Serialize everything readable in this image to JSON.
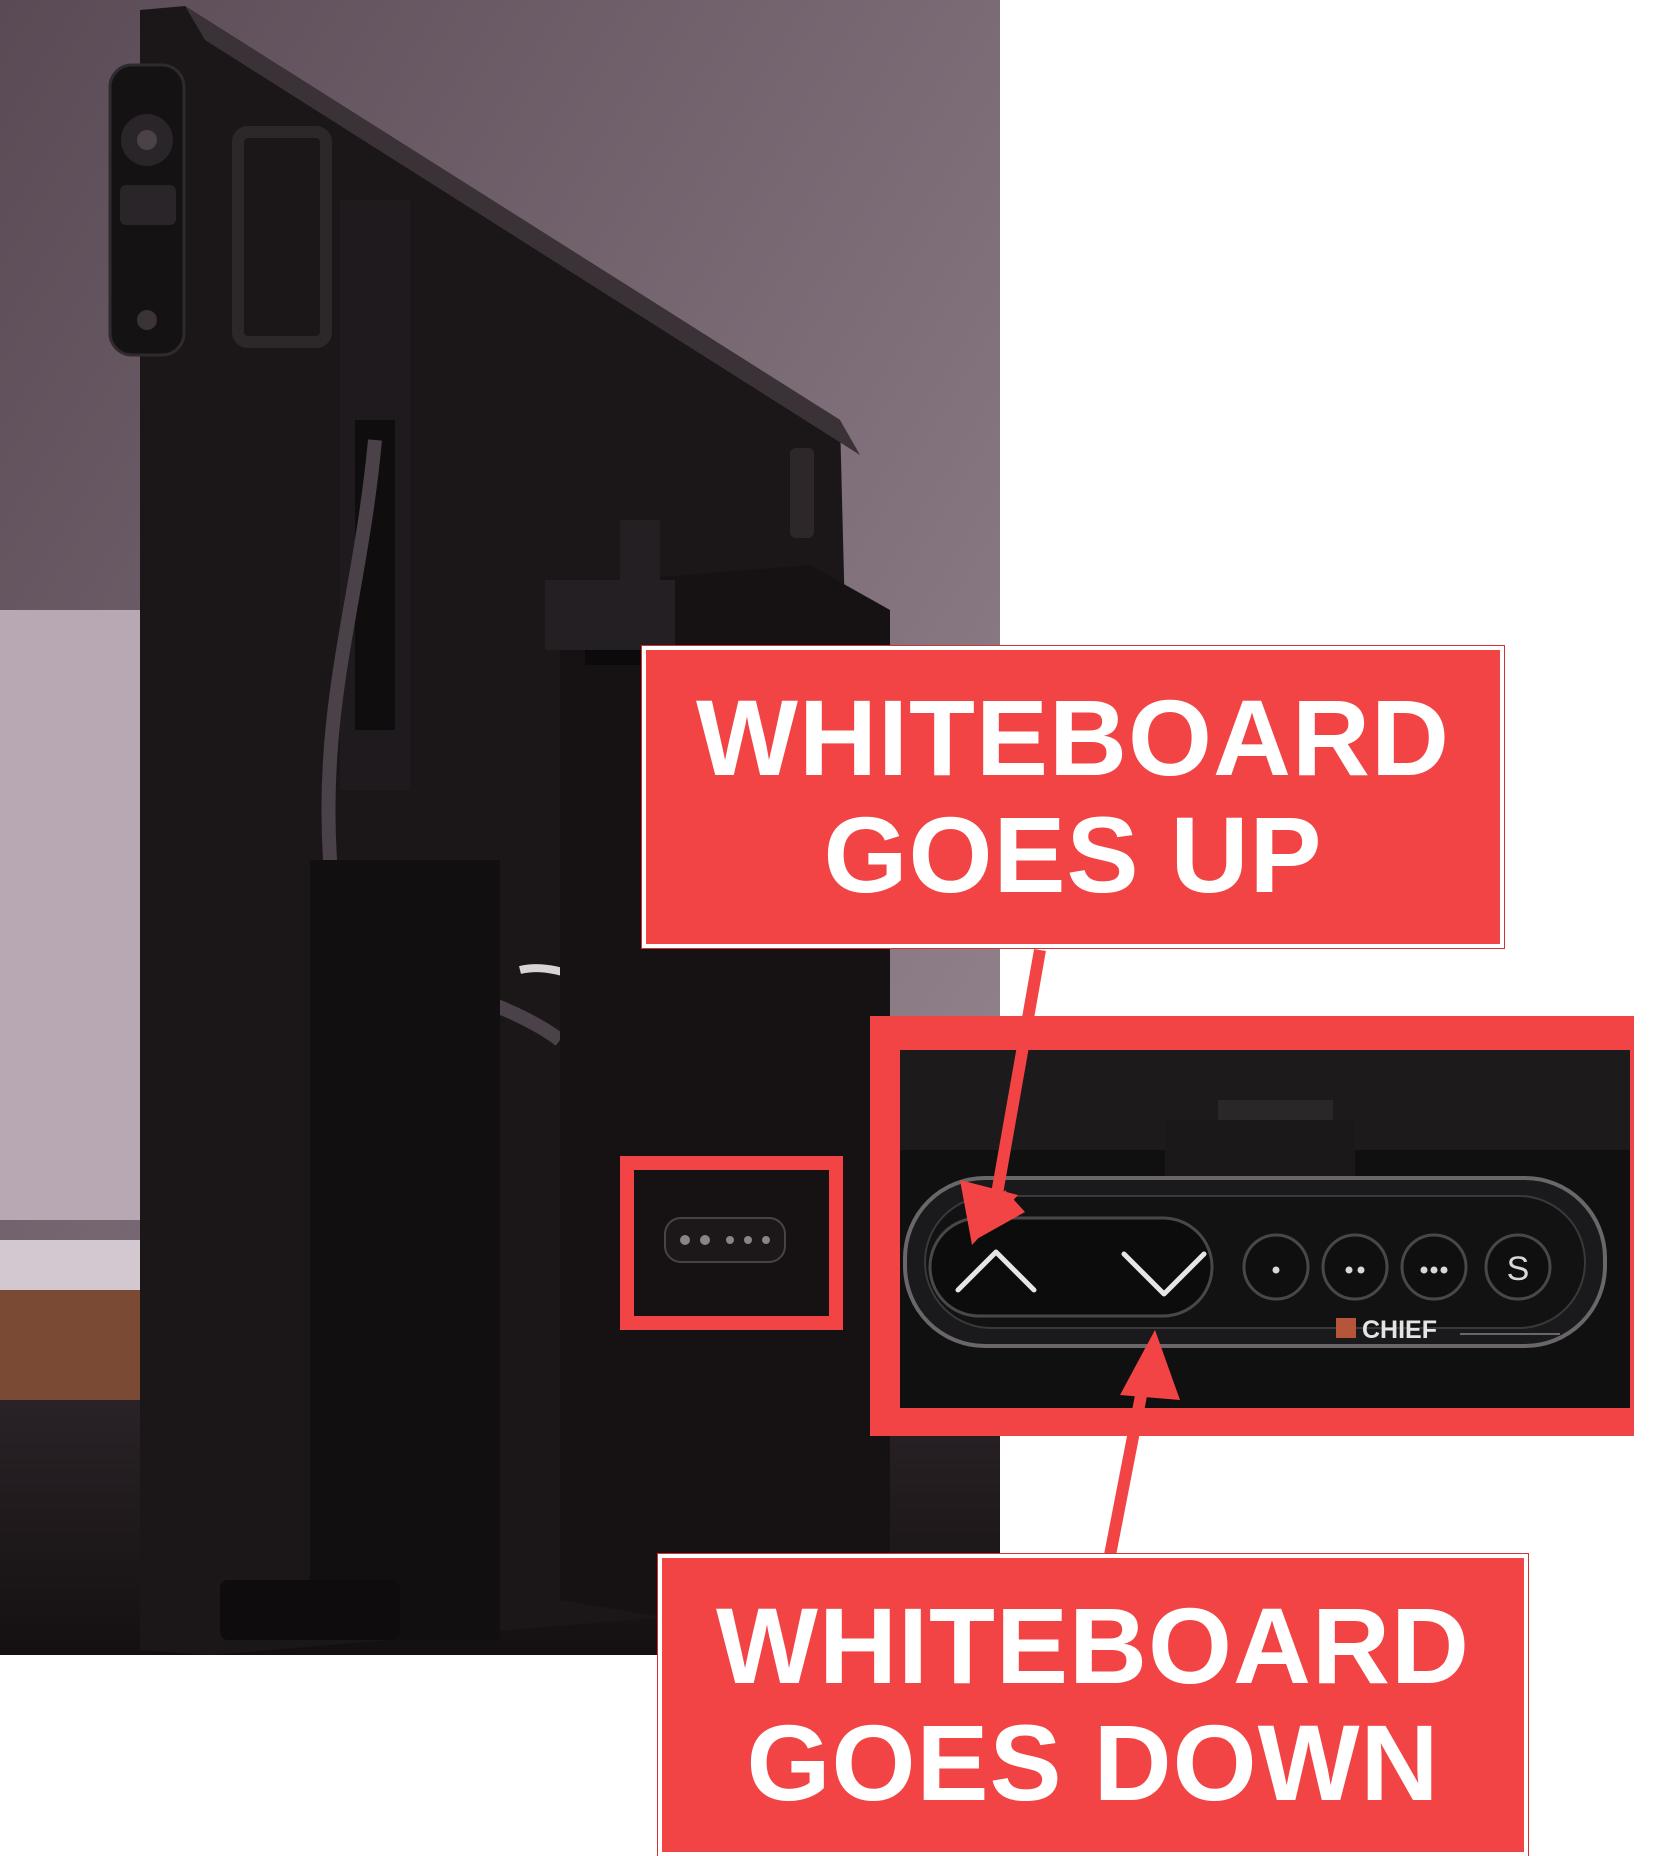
{
  "callouts": {
    "up": {
      "line1": "WHITEBOARD",
      "line2": "GOES UP"
    },
    "down": {
      "line1": "WHITEBOARD",
      "line2": "GOES DOWN"
    }
  },
  "keypad": {
    "brand": "CHIEF",
    "preset_s_label": "S"
  },
  "colors": {
    "callout_red": "#f24444",
    "highlight_red": "#f24444",
    "keypad_body": "#1a1a1c"
  }
}
